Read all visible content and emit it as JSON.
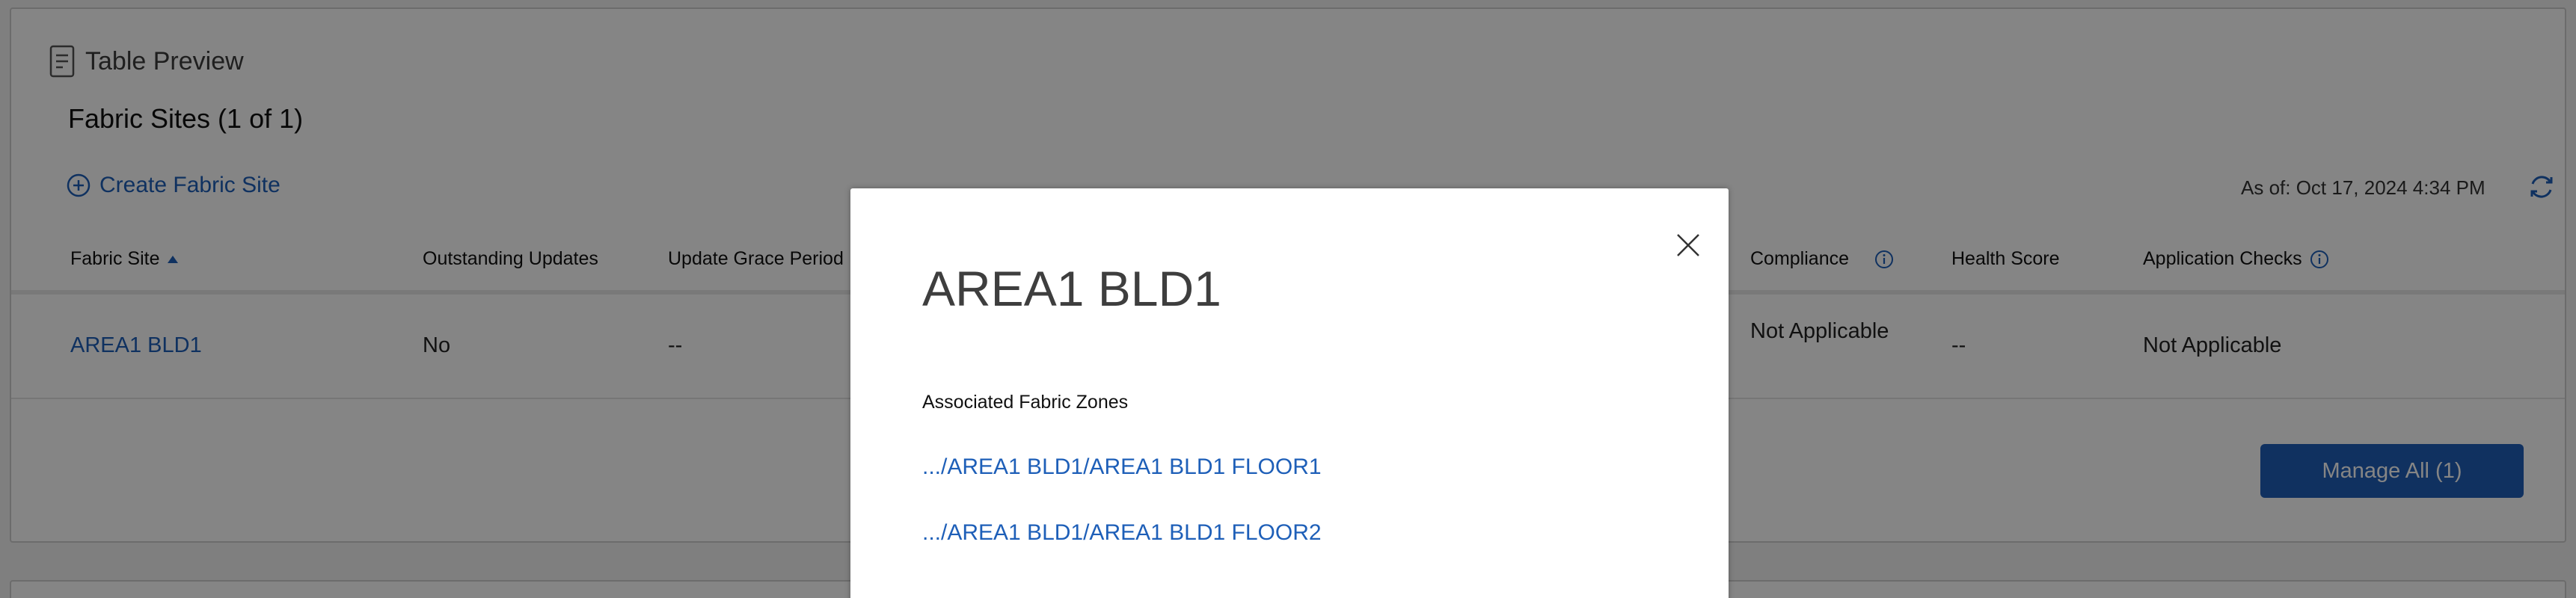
{
  "preview": {
    "title": "Table Preview",
    "section_title": "Fabric Sites (1 of 1)",
    "create_link": "Create Fabric Site",
    "as_of": "As of: Oct 17, 2024 4:34 PM"
  },
  "table": {
    "columns": [
      {
        "label": "Fabric Site",
        "sorted": "asc"
      },
      {
        "label": "Outstanding Updates"
      },
      {
        "label": "Update Grace Period"
      },
      {
        "label": "Compliance",
        "info": true
      },
      {
        "label": "Health Score"
      },
      {
        "label": "Application Checks",
        "info": true
      }
    ],
    "rows": [
      {
        "fabric_site": "AREA1 BLD1",
        "outstanding_updates": "No",
        "update_grace_period": "--",
        "compliance": "Not Applicable",
        "health_score": "--",
        "application_checks": "Not Applicable"
      }
    ]
  },
  "manage_button": "Manage All (1)",
  "modal": {
    "title": "AREA1 BLD1",
    "zones_label": "Associated Fabric Zones",
    "zones": [
      ".../AREA1 BLD1/AREA1 BLD1 FLOOR1",
      ".../AREA1 BLD1/AREA1 BLD1 FLOOR2"
    ]
  },
  "colors": {
    "link": "#1e5fb8",
    "primary_button": "#1f5fb8",
    "overlay": "rgba(0,0,0,0.48)"
  }
}
